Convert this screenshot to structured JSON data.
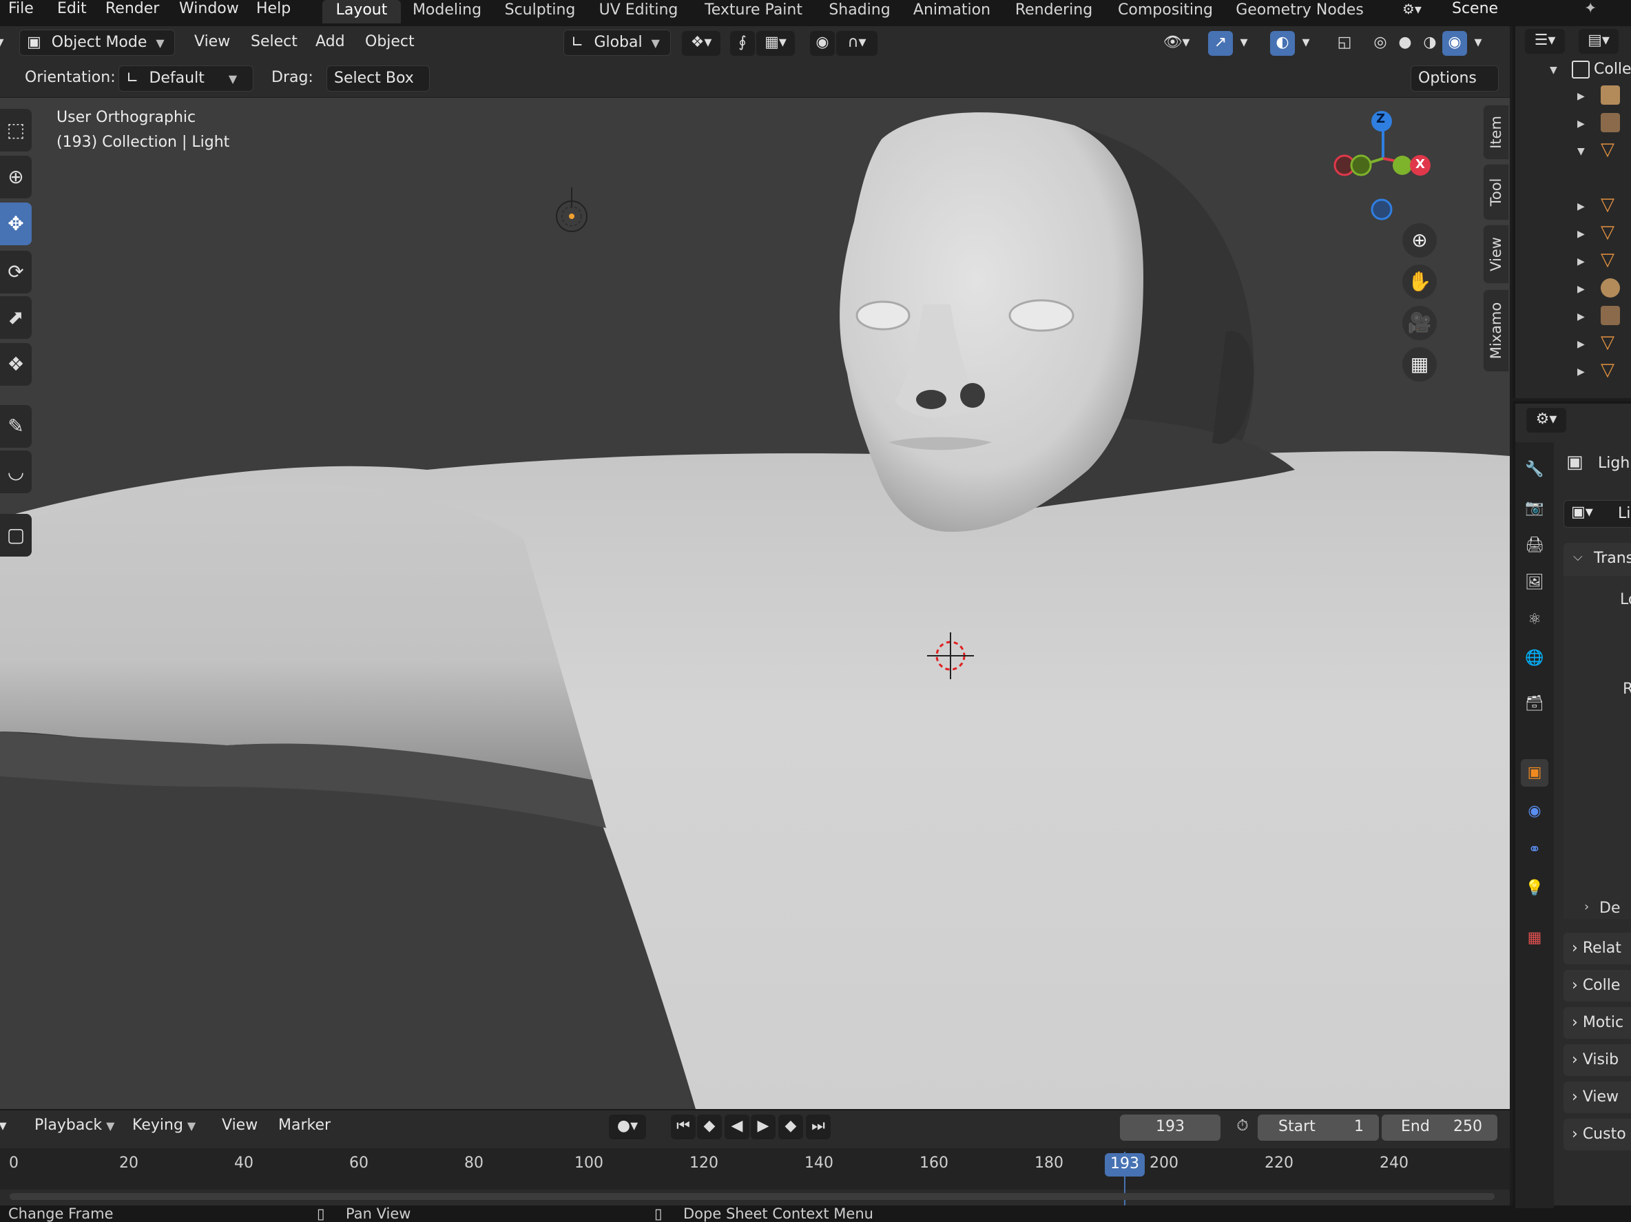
{
  "top_menu": [
    "File",
    "Edit",
    "Render",
    "Window",
    "Help"
  ],
  "workspaces": {
    "items": [
      "Layout",
      "Modeling",
      "Sculpting",
      "UV Editing",
      "Texture Paint",
      "Shading",
      "Animation",
      "Rendering",
      "Compositing",
      "Geometry Nodes"
    ],
    "active": "Layout"
  },
  "scene_name": "Scene",
  "viewport_header": {
    "mode": "Object Mode",
    "menus": [
      "View",
      "Select",
      "Add",
      "Object"
    ],
    "transform_orientation": "Global"
  },
  "tool_settings": {
    "orientation_label": "Orientation:",
    "orientation_value": "Default",
    "drag_label": "Drag:",
    "drag_value": "Select Box",
    "options_label": "Options"
  },
  "viewport": {
    "view_name": "User Orthographic",
    "context_line": "(193) Collection | Light",
    "gizmo_axes": {
      "z": "Z",
      "x": "X"
    },
    "colors": {
      "background": "#3d3d3d",
      "mesh": "#d4d4d4",
      "active_tool": "#4772b3",
      "axis_x": "#e0384a",
      "axis_y": "#7eb32c",
      "axis_z": "#2f7fe0"
    }
  },
  "n_panel_tabs": [
    "Item",
    "Tool",
    "View",
    "Mixamo"
  ],
  "timeline": {
    "menus": [
      "Playback",
      "Keying",
      "View",
      "Marker"
    ],
    "current_frame": "193",
    "start_label": "Start",
    "start_value": "1",
    "end_label": "End",
    "end_value": "250",
    "ruler_ticks": [
      "0",
      "20",
      "40",
      "60",
      "80",
      "100",
      "120",
      "140",
      "160",
      "180",
      "200",
      "220",
      "240"
    ],
    "playhead_label": "193"
  },
  "status_bar": {
    "left": "Change Frame",
    "middle": "Pan View",
    "right": "Dope Sheet Context Menu"
  },
  "outliner": {
    "root_label": "Colle"
  },
  "properties": {
    "object_name": "Ligh",
    "data_field": "Li",
    "transform_header": "Trans",
    "location_label": "Lo",
    "rotation_label": "R",
    "delta_label": "De",
    "panels": [
      "Relat",
      "Colle",
      "Motic",
      "Visib",
      "View",
      "Custo"
    ]
  }
}
